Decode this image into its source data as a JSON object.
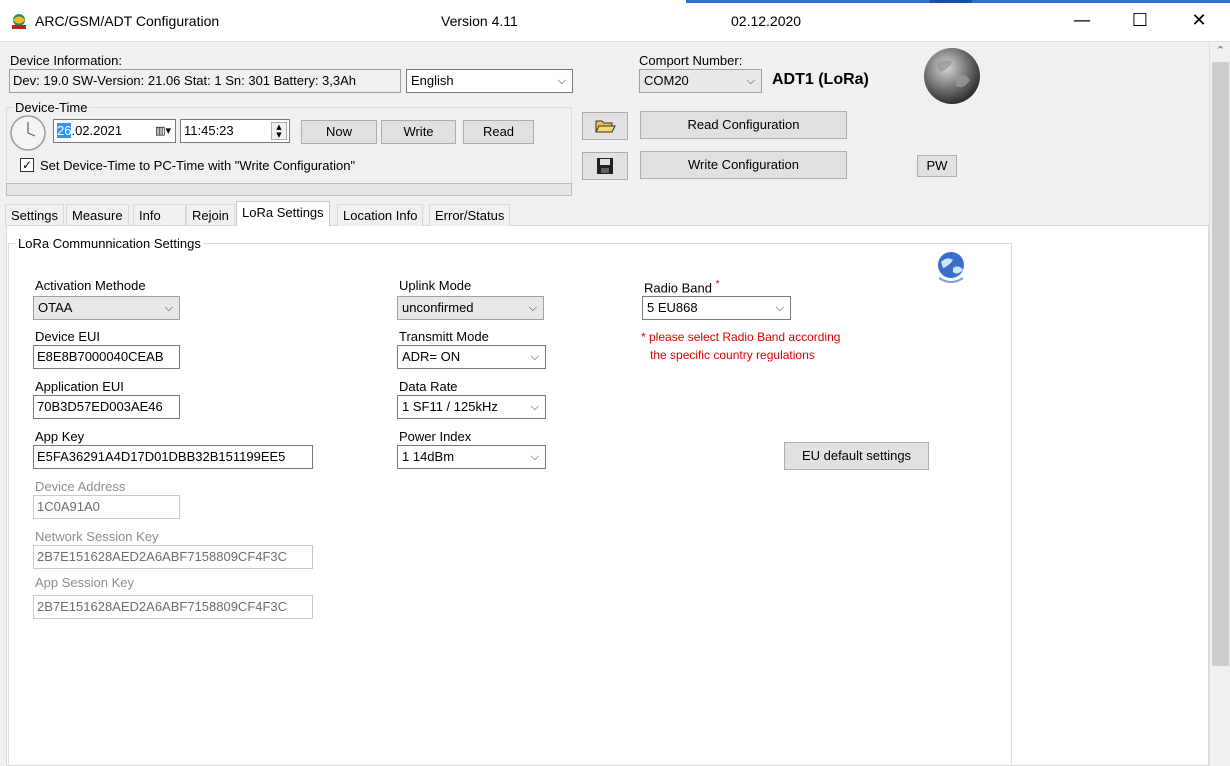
{
  "window": {
    "title": "ARC/GSM/ADT Configuration",
    "version": "Version 4.11",
    "date": "02.12.2020",
    "minimize": "—",
    "maximize": "☐",
    "close": "✕"
  },
  "device_info": {
    "label": "Device Information:",
    "value": "Dev: 19.0 SW-Version: 21.06 Stat: 1 Sn: 301 Battery: 3,3Ah",
    "language": "English"
  },
  "device_time": {
    "label": "Device-Time",
    "date": "26.02.2021",
    "date_highlight": "26",
    "date_rest": ".02.2021",
    "time": "11:45:23",
    "now": "Now",
    "write": "Write",
    "read": "Read",
    "sync_label": "Set Device-Time to PC-Time with \"Write Configuration\"",
    "sync_checked": true
  },
  "comport": {
    "label": "Comport Number:",
    "value": "COM20",
    "device_name": "ADT1 (LoRa)"
  },
  "actions": {
    "read_config": "Read Configuration",
    "write_config": "Write Configuration",
    "pw": "PW"
  },
  "tabs": [
    {
      "label": "Settings"
    },
    {
      "label": "Measure"
    },
    {
      "label": "Info"
    },
    {
      "label": "Rejoin"
    },
    {
      "label": "LoRa Settings",
      "active": true
    },
    {
      "label": "Location Info"
    },
    {
      "label": "Error/Status"
    }
  ],
  "lora": {
    "group_title": "LoRa Communnication Settings",
    "activation_label": "Activation Methode",
    "activation_value": "OTAA",
    "device_eui_label": "Device EUI",
    "device_eui_value": "E8E8B7000040CEAB",
    "app_eui_label": "Application EUI",
    "app_eui_value": "70B3D57ED003AE46",
    "app_key_label": "App Key",
    "app_key_value": "E5FA36291A4D17D01DBB32B151199EE5",
    "dev_addr_label": "Device Address",
    "dev_addr_value": "1C0A91A0",
    "nwk_key_label": "Network Session Key",
    "nwk_key_value": "2B7E151628AED2A6ABF7158809CF4F3C",
    "app_skey_label": "App Session Key",
    "app_skey_value": "2B7E151628AED2A6ABF7158809CF4F3C",
    "uplink_label": "Uplink Mode",
    "uplink_value": "unconfirmed",
    "transmit_label": "Transmitt Mode",
    "transmit_value": "ADR= ON",
    "datarate_label": "Data Rate",
    "datarate_value": "1  SF11 / 125kHz",
    "power_label": "Power Index",
    "power_value": "1  14dBm",
    "band_label": "Radio Band",
    "band_star": "*",
    "band_value": "5  EU868",
    "band_note_1": "* please select Radio Band according",
    "band_note_2": "the specific country regulations",
    "eu_default": "EU default settings"
  },
  "colors": {
    "accent": "#2a6fd6",
    "warning": "#e00000",
    "selection": "#3390ff"
  }
}
